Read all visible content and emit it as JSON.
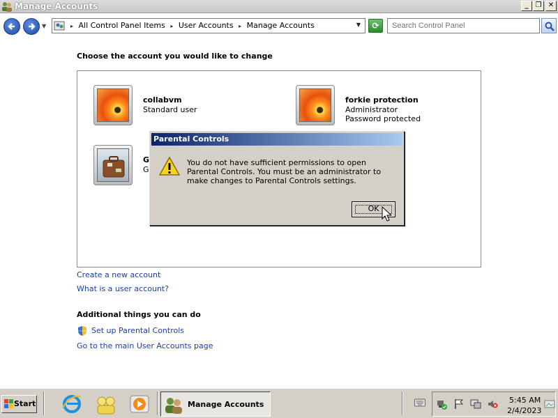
{
  "window": {
    "title": "Manage Accounts"
  },
  "navigation": {
    "breadcrumbs": [
      "All Control Panel Items",
      "User Accounts",
      "Manage Accounts"
    ],
    "search_placeholder": "Search Control Panel"
  },
  "main": {
    "heading": "Choose the account you would like to change",
    "accounts": [
      {
        "name": "collabvm",
        "line1": "Standard user",
        "line2": ""
      },
      {
        "name": "forkie protection",
        "line1": "Administrator",
        "line2": "Password protected"
      },
      {
        "name": "G",
        "line1": "Gu",
        "line2": ""
      }
    ],
    "links": {
      "create": "Create a new account",
      "what_is": "What is a user account?"
    },
    "additional_heading": "Additional things you can do",
    "additional_links": {
      "parental": "Set up Parental Controls",
      "main_page": "Go to the main User Accounts page"
    }
  },
  "dialog": {
    "title": "Parental Controls",
    "message": "You do not have sufficient permissions to open Parental Controls. You must be an administrator to make changes to Parental Controls settings.",
    "ok_label": "OK"
  },
  "taskbar": {
    "start_label": "Start",
    "active_item": "Manage Accounts",
    "clock_time": "5:45 AM",
    "clock_date": "2/4/2023"
  },
  "colors": {
    "link": "#1c3ea3",
    "dialog_title_start": "#0a246a",
    "dialog_title_end": "#a6caf0",
    "chrome": "#d4d0c8"
  }
}
